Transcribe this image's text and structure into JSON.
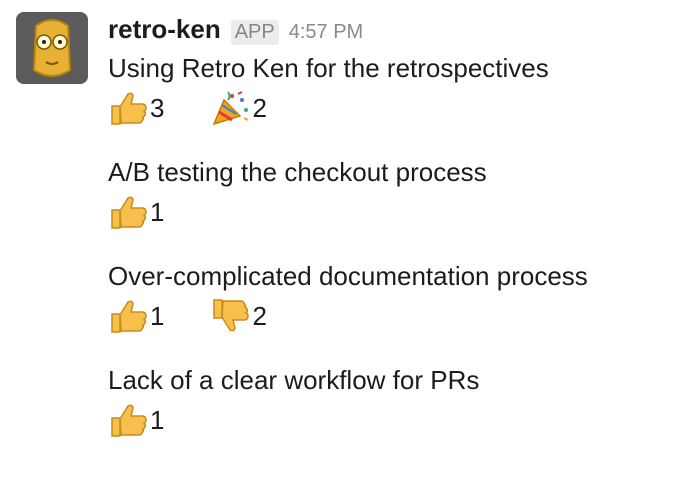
{
  "message": {
    "sender": "retro-ken",
    "badge": "APP",
    "timestamp": "4:57 PM",
    "items": [
      {
        "text": "Using Retro Ken for the retrospectives",
        "reactions": [
          {
            "emoji": "thumbs-up-icon",
            "count": "3"
          },
          {
            "emoji": "party-popper-icon",
            "count": "2"
          }
        ]
      },
      {
        "text": "A/B testing the checkout process",
        "reactions": [
          {
            "emoji": "thumbs-up-icon",
            "count": "1"
          }
        ]
      },
      {
        "text": "Over-complicated documentation process",
        "reactions": [
          {
            "emoji": "thumbs-up-icon",
            "count": "1"
          },
          {
            "emoji": "thumbs-down-icon",
            "count": "2"
          }
        ]
      },
      {
        "text": "Lack of a clear workflow for PRs",
        "reactions": [
          {
            "emoji": "thumbs-up-icon",
            "count": "1"
          }
        ]
      }
    ]
  },
  "colors": {
    "emoji_yellow": "#f7c04a",
    "emoji_outline": "#c98a1c",
    "avatar_bg": "#5b5b5b",
    "avatar_face": "#e8b135"
  }
}
